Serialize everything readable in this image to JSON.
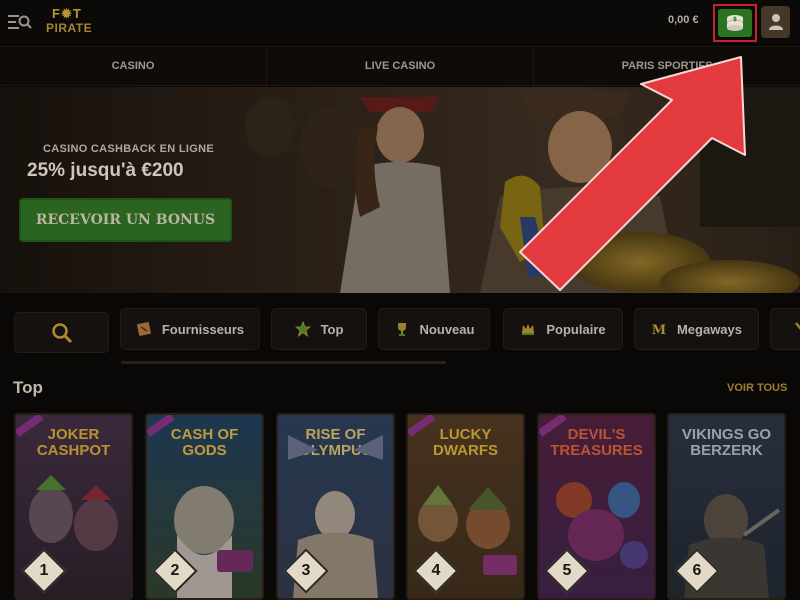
{
  "header": {
    "menu_icon": "menu-search-icon",
    "logo_line1": "F✹T",
    "logo_line2": "PIRATE",
    "balance": "0,00 €",
    "wallet_icon": "coins-icon",
    "account_icon": "user-icon"
  },
  "nav": {
    "tabs": [
      {
        "label": "CASINO"
      },
      {
        "label": "LIVE CASINO"
      },
      {
        "label": "PARIS SPORTIFS"
      }
    ]
  },
  "banner": {
    "kicker": "CASINO CASHBACK EN LIGNE",
    "headline": "25% jusqu'à €200",
    "cta": "RECEVOIR UN BONUS"
  },
  "filters": {
    "search_icon": "search-icon",
    "chips": [
      {
        "label": "Fournisseurs",
        "icon": "map-icon"
      },
      {
        "label": "Top",
        "icon": "star-icon"
      },
      {
        "label": "Nouveau",
        "icon": "trophy-icon"
      },
      {
        "label": "Populaire",
        "icon": "crown-icon"
      },
      {
        "label": "Megaways",
        "icon": "megaways-icon"
      }
    ]
  },
  "top": {
    "title": "Top",
    "view_all": "VOIR TOUS",
    "games": [
      {
        "title": "Joker Cashpot",
        "rank": "1"
      },
      {
        "title": "Cash of Gods",
        "rank": "2"
      },
      {
        "title": "Rise of Olympus",
        "rank": "3"
      },
      {
        "title": "Lucky Dwarfs",
        "rank": "4"
      },
      {
        "title": "Devil's Treasures",
        "rank": "5"
      },
      {
        "title": "Vikings go Berzerk",
        "rank": "6"
      }
    ]
  },
  "colors": {
    "highlight": "#d1262b",
    "wallet_green": "#2f7a23",
    "accent_gold": "#a68737"
  }
}
